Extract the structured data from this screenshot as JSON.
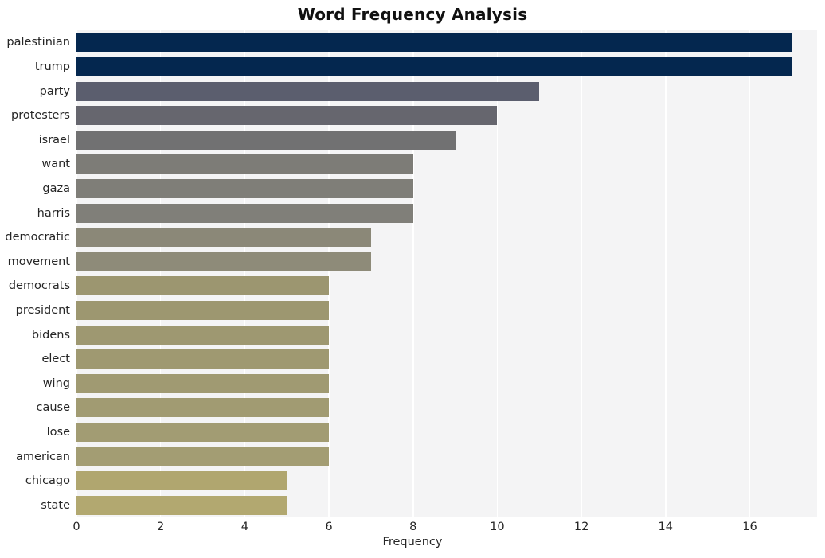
{
  "chart_data": {
    "type": "bar",
    "orientation": "horizontal",
    "title": "Word Frequency Analysis",
    "xlabel": "Frequency",
    "ylabel": "",
    "categories": [
      "palestinian",
      "trump",
      "party",
      "protesters",
      "israel",
      "want",
      "gaza",
      "harris",
      "democratic",
      "movement",
      "democrats",
      "president",
      "bidens",
      "elect",
      "wing",
      "cause",
      "lose",
      "american",
      "chicago",
      "state"
    ],
    "values": [
      17,
      17,
      11,
      10,
      9,
      8,
      8,
      8,
      7,
      7,
      6,
      6,
      6,
      6,
      6,
      6,
      6,
      6,
      5,
      5
    ],
    "xlim": [
      0,
      17.6
    ],
    "xticks": [
      0,
      2,
      4,
      6,
      8,
      10,
      12,
      14,
      16
    ],
    "xtick_labels": [
      "0",
      "2",
      "4",
      "6",
      "8",
      "10",
      "12",
      "14",
      "16"
    ],
    "grid": "vertical-white-on-gray",
    "legend": "none",
    "bar_colors": [
      "#04274f",
      "#04274f",
      "#5b5e6e",
      "#66666e",
      "#717172",
      "#7d7c77",
      "#7f7e78",
      "#807f79",
      "#8b8878",
      "#8e8b79",
      "#9c9670",
      "#9d9770",
      "#9e9871",
      "#9f9971",
      "#a09a72",
      "#a19b72",
      "#a29c73",
      "#a39d73",
      "#b0a66f",
      "#b2a870"
    ],
    "plot_background": "#f4f4f5",
    "gridline_color": "#ffffff",
    "title_color": "#111111",
    "tick_label_color": "#262626"
  }
}
